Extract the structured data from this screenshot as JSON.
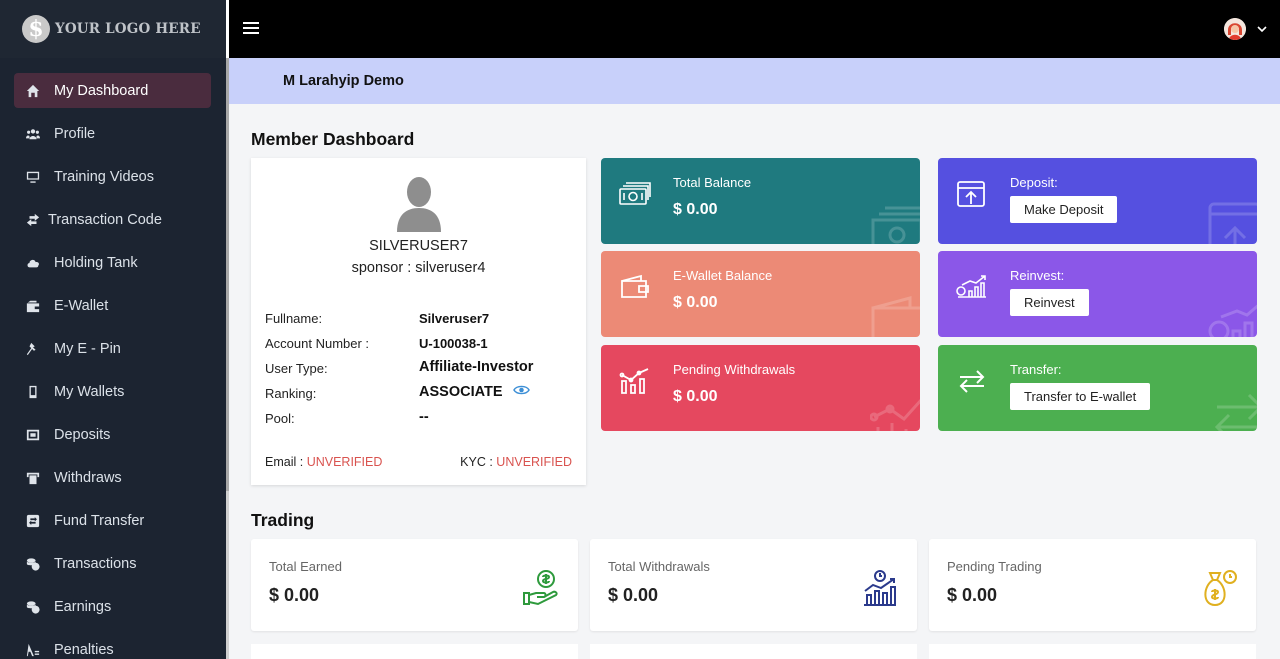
{
  "logo": {
    "symbol": "$",
    "text": "YOUR LOGO HERE"
  },
  "sidebar": {
    "items": [
      {
        "label": "My Dashboard",
        "icon": "home-icon",
        "active": true
      },
      {
        "label": "Profile",
        "icon": "users-icon"
      },
      {
        "label": "Training Videos",
        "icon": "monitor-icon"
      },
      {
        "label": "Transaction Code",
        "icon": "exchange-icon"
      },
      {
        "label": "Holding Tank",
        "icon": "cloud-icon"
      },
      {
        "label": "E-Wallet",
        "icon": "wallet-icon"
      },
      {
        "label": "My E - Pin",
        "icon": "pin-icon"
      },
      {
        "label": "My Wallets",
        "icon": "phone-icon"
      },
      {
        "label": "Deposits",
        "icon": "deposit-icon"
      },
      {
        "label": "Withdraws",
        "icon": "atm-icon"
      },
      {
        "label": "Fund Transfer",
        "icon": "transfer-icon"
      },
      {
        "label": "Transactions",
        "icon": "coins-icon"
      },
      {
        "label": "Earnings",
        "icon": "coins-icon"
      },
      {
        "label": "Penalties",
        "icon": "penalty-icon"
      }
    ]
  },
  "banner": {
    "title": "M Larahyip Demo"
  },
  "member_dashboard": {
    "title": "Member Dashboard",
    "profile": {
      "username": "SILVERUSER7",
      "sponsor": "sponsor : silveruser4",
      "fields": [
        {
          "label": "Fullname:",
          "value": "Silveruser7"
        },
        {
          "label": "Account Number :",
          "value": "U-100038-1"
        },
        {
          "label": "User Type:",
          "value": "Affiliate-Investor"
        },
        {
          "label": "Ranking:",
          "value": "ASSOCIATE"
        },
        {
          "label": "Pool:",
          "value": "--"
        }
      ],
      "email_label": "Email : ",
      "email_status": "UNVERIFIED",
      "kyc_label": "KYC : ",
      "kyc_status": "UNVERIFIED"
    },
    "stats": {
      "total_balance": {
        "title": "Total Balance",
        "value": "$ 0.00",
        "color": "#1f7a7f"
      },
      "ewallet_balance": {
        "title": "E-Wallet Balance",
        "value": "$ 0.00",
        "color": "#ec8a76"
      },
      "pending_withdrawals": {
        "title": "Pending Withdrawals",
        "value": "$ 0.00",
        "color": "#e5485f"
      },
      "deposit": {
        "title": "Deposit:",
        "button": "Make Deposit",
        "color": "#5550e0"
      },
      "reinvest": {
        "title": "Reinvest:",
        "button": "Reinvest",
        "color": "#8b57e8"
      },
      "transfer": {
        "title": "Transfer:",
        "button": "Transfer to E-wallet",
        "color": "#4caf50"
      }
    }
  },
  "trading": {
    "title": "Trading",
    "cards": [
      {
        "title": "Total Earned",
        "value": "$ 0.00",
        "icon": "money-hand-icon"
      },
      {
        "title": "Total Withdrawals",
        "value": "$ 0.00",
        "icon": "chart-growth-icon"
      },
      {
        "title": "Pending Trading",
        "value": "$ 0.00",
        "icon": "money-bag-icon"
      }
    ]
  }
}
